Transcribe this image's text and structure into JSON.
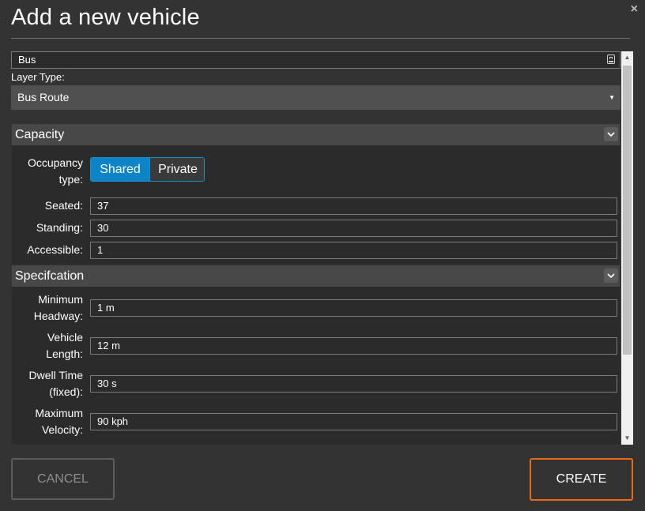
{
  "dialog": {
    "title": "Add a new vehicle",
    "close_label": "×"
  },
  "vehicle_name": {
    "value": "Bus",
    "icon": "keyboard-icon"
  },
  "layer_type": {
    "label": "Layer Type:",
    "selected": "Bus Route"
  },
  "capacity": {
    "title": "Capacity",
    "occupancy_label_line1": "Occupancy",
    "occupancy_label_line2": "type:",
    "occupancy_options": [
      "Shared",
      "Private"
    ],
    "occupancy_selected": "Shared",
    "fields": [
      {
        "label": "Seated:",
        "value": "37"
      },
      {
        "label": "Standing:",
        "value": "30"
      },
      {
        "label": "Accessible:",
        "value": "1"
      }
    ]
  },
  "specification": {
    "title": "Specifcation",
    "fields": [
      {
        "label_line1": "Minimum",
        "label_line2": "Headway:",
        "value": "1 m"
      },
      {
        "label_line1": "Vehicle",
        "label_line2": "Length:",
        "value": "12 m"
      },
      {
        "label_line1": "Dwell Time",
        "label_line2": "(fixed):",
        "value": "30 s"
      },
      {
        "label_line1": "Maximum",
        "label_line2": "Velocity:",
        "value": "90 kph"
      }
    ]
  },
  "footer": {
    "cancel_label": "CANCEL",
    "create_label": "CREATE"
  },
  "colors": {
    "accent_blue": "#0d84c8",
    "accent_orange": "#ec6a17",
    "background": "#333333"
  }
}
